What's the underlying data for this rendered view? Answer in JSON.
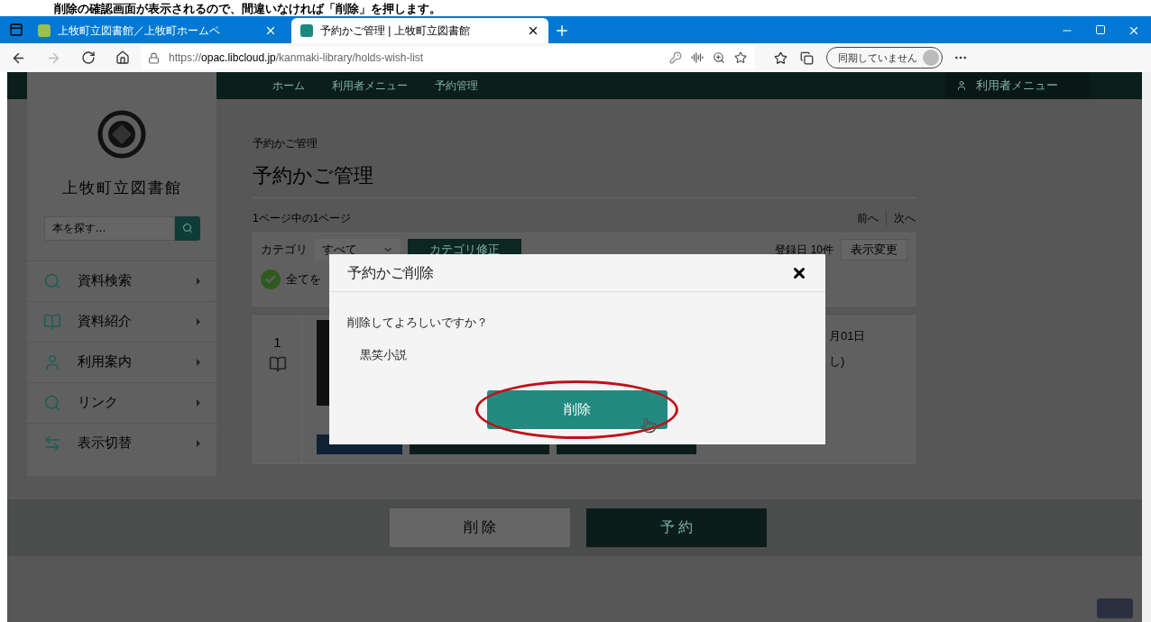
{
  "caption": "削除の確認画面が表示されるので、間違いなければ「削除」を押します。",
  "browser": {
    "tabs": [
      {
        "title": "上牧町立図書館／上牧町ホームペ",
        "selected": false
      },
      {
        "title": "予約かご管理 | 上牧町立図書館",
        "selected": true
      }
    ],
    "url_prefix": "https://",
    "url_host": "opac.libcloud.jp",
    "url_path": "/kanmaki-library/holds-wish-list",
    "profile": "同期していません"
  },
  "navbar": {
    "breadcrumbs": [
      "ホーム",
      "利用者メニュー",
      "予約管理"
    ],
    "user_menu": "利用者メニュー"
  },
  "sidebar": {
    "library_name": "上牧町立図書館",
    "search_placeholder": "本を探す…",
    "items": [
      {
        "label": "資料検索",
        "kind": "search"
      },
      {
        "label": "資料紹介",
        "kind": "book"
      },
      {
        "label": "利用案内",
        "kind": "user"
      },
      {
        "label": "リンク",
        "kind": "search"
      },
      {
        "label": "表示切替",
        "kind": "switch"
      }
    ]
  },
  "main": {
    "breadcrumb": "予約かご管理",
    "title": "予約かご管理",
    "page_info": "1ページ中の1ページ",
    "prev": "前へ",
    "next": "次へ",
    "category_label": "カテゴリ",
    "category_value": "すべて",
    "category_edit": "カテゴリ修正",
    "sort": "登録日 10件",
    "display_change": "表示変更",
    "select_all": "全てを",
    "item": {
      "number": "1",
      "date": "月01日",
      "note": "し)"
    }
  },
  "footer_buttons": [
    "削 除",
    "予 約"
  ],
  "dialog": {
    "title": "予約かご削除",
    "message": "削除してよろしいですか？",
    "book_title": "黒笑小説",
    "confirm": "削除"
  }
}
